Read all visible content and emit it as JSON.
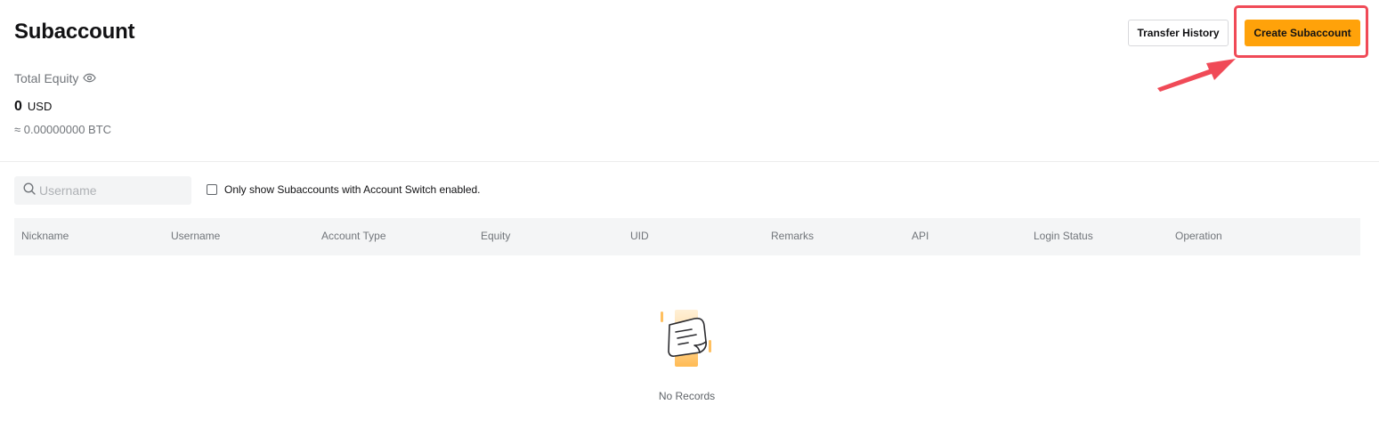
{
  "header": {
    "title": "Subaccount",
    "transfer_history_label": "Transfer History",
    "create_subaccount_label": "Create Subaccount"
  },
  "equity": {
    "label": "Total Equity",
    "value": "0",
    "unit": "USD",
    "btc_approx": "≈ 0.00000000 BTC"
  },
  "filters": {
    "search_placeholder": "Username",
    "search_value": "",
    "switch_filter_label": "Only show Subaccounts with Account Switch enabled.",
    "switch_filter_checked": false
  },
  "table": {
    "columns": [
      "Nickname",
      "Username",
      "Account Type",
      "Equity",
      "UID",
      "Remarks",
      "API",
      "Login Status",
      "Operation"
    ],
    "rows": [],
    "empty_text": "No Records"
  },
  "colors": {
    "accent": "#ffa20a",
    "highlight": "#f04a57"
  },
  "icons": {
    "equity_visibility": "eye-icon",
    "search": "search-icon",
    "empty_state": "empty-document-icon"
  }
}
